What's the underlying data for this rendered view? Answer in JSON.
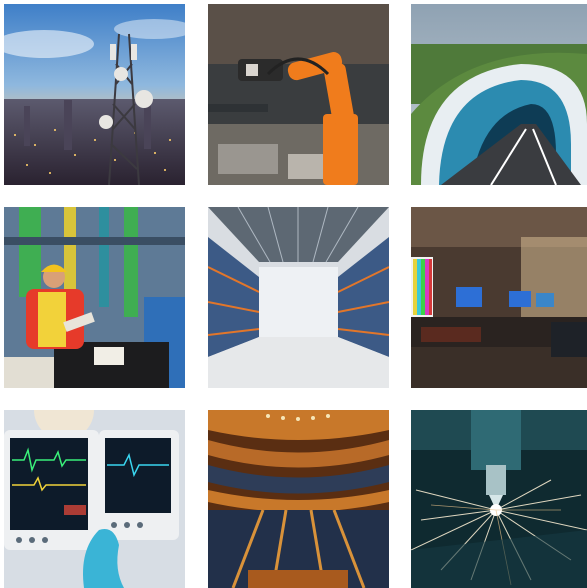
{
  "gallery": {
    "columns": 3,
    "rows": 3,
    "tiles": [
      {
        "subject": "telecom-tower-city-dusk"
      },
      {
        "subject": "orange-industrial-robot-arm"
      },
      {
        "subject": "highway-tunnel-entrance"
      },
      {
        "subject": "engineer-hard-hat-pipes"
      },
      {
        "subject": "empty-warehouse-racks"
      },
      {
        "subject": "broadcast-control-room"
      },
      {
        "subject": "patient-monitor-hospital"
      },
      {
        "subject": "concert-hall-auditorium"
      },
      {
        "subject": "laser-cutting-sparks"
      }
    ]
  }
}
